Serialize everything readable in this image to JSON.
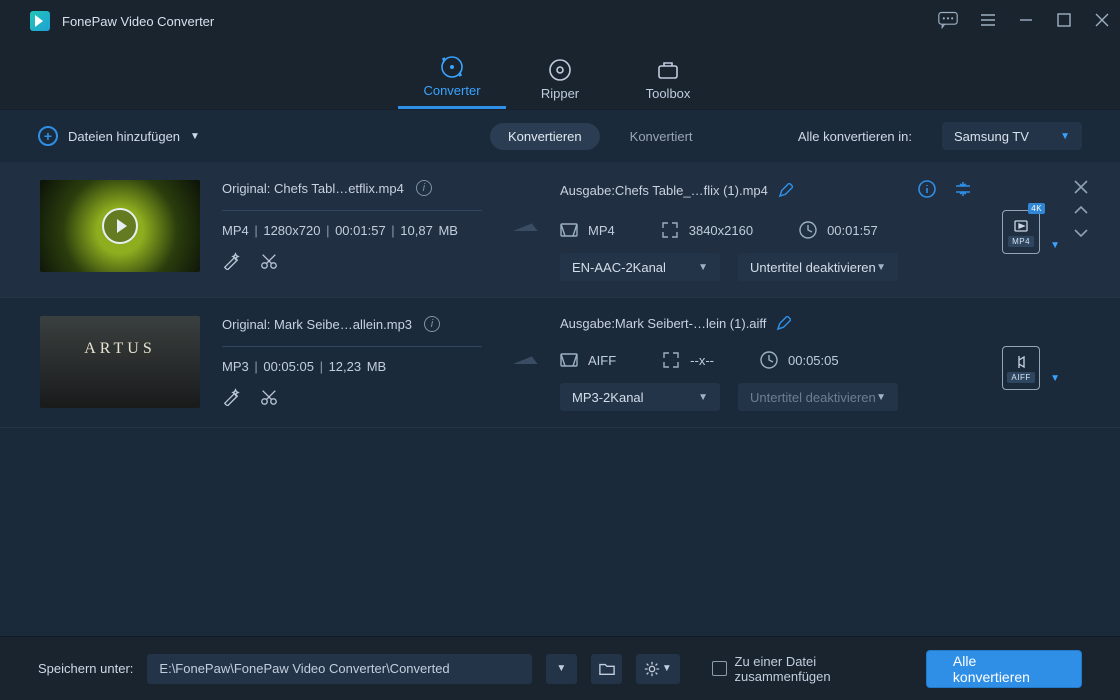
{
  "app_title": "FonePaw Video Converter",
  "tabs": {
    "converter": "Converter",
    "ripper": "Ripper",
    "toolbox": "Toolbox"
  },
  "toolbar": {
    "add_files": "Dateien hinzufügen",
    "tab_convert": "Konvertieren",
    "tab_converted": "Konvertiert",
    "convert_all_to": "Alle konvertieren in:",
    "preset": "Samsung TV"
  },
  "items": [
    {
      "original_line": "Original: Chefs Tabl…etflix.mp4",
      "meta": [
        "MP4",
        "1280x720",
        "00:01:57",
        "10,87 MB"
      ],
      "output_line": "Ausgabe:Chefs Table_…flix (1).mp4",
      "out_format": "MP4",
      "out_res": "3840x2160",
      "out_dur": "00:01:57",
      "audio_sel": "EN-AAC-2Kanal",
      "sub_sel": "Untertitel deaktivieren",
      "badge": {
        "tag": "4K",
        "band": "MP4"
      }
    },
    {
      "original_line": "Original: Mark Seibe…allein.mp3",
      "meta": [
        "MP3",
        "00:05:05",
        "12,23 MB"
      ],
      "output_line": "Ausgabe:Mark Seibert-…lein (1).aiff",
      "out_format": "AIFF",
      "out_res": "--x--",
      "out_dur": "00:05:05",
      "audio_sel": "MP3-2Kanal",
      "sub_sel": "Untertitel deaktivieren",
      "badge": {
        "tag": "",
        "band": "AIFF"
      }
    }
  ],
  "bottom": {
    "save_under": "Speichern unter:",
    "path": "E:\\FonePaw\\FonePaw Video Converter\\Converted",
    "merge": "Zu einer Datei zusammenfügen",
    "convert_all": "Alle konvertieren"
  }
}
